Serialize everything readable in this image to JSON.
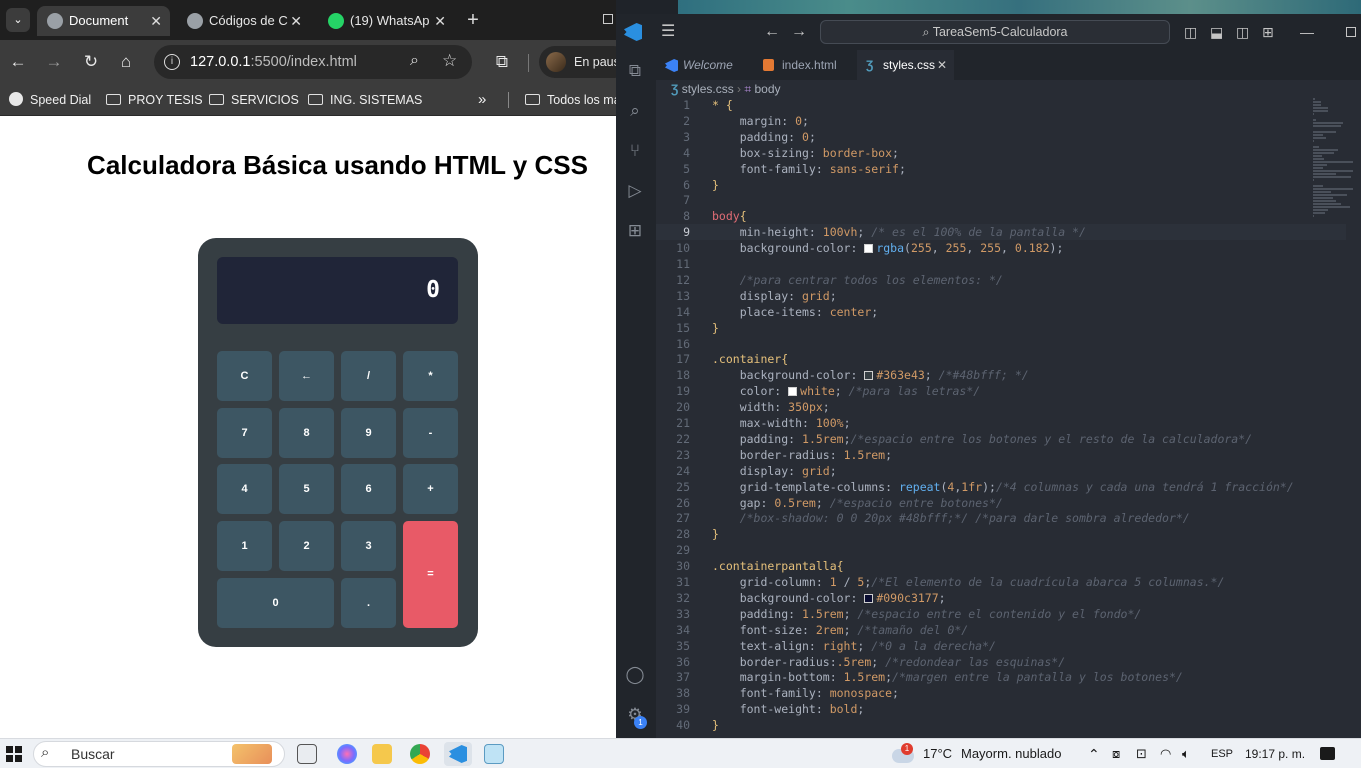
{
  "browser": {
    "tabs": [
      {
        "label": "Document",
        "active": true,
        "icon": "globe-icon"
      },
      {
        "label": "Códigos de C",
        "active": false,
        "icon": "globe-icon"
      },
      {
        "label": "(19) WhatsAp",
        "active": false,
        "icon": "whatsapp-icon"
      }
    ],
    "close_glyph": "✕",
    "new_tab_glyph": "+",
    "url_host": "127.0.0.1",
    "url_rest": ":5500/index.html",
    "profile_label": "En paus",
    "bookmarks": [
      "Speed Dial",
      "PROY TESIS",
      "SERVICIOS",
      "ING. SISTEMAS",
      "»",
      "Todos los ma"
    ]
  },
  "page": {
    "title": "Calculadora Básica usando HTML y CSS",
    "display": "0",
    "keys": [
      "C",
      "←",
      "/",
      "*",
      "7",
      "8",
      "9",
      "-",
      "4",
      "5",
      "6",
      "+",
      "1",
      "2",
      "3",
      "=",
      "0",
      "."
    ],
    "colors": {
      "calc_bg": "#363e43",
      "screen_bg": "#202538",
      "key_bg": "#3d5663",
      "equals_bg": "#e85a67"
    }
  },
  "vscode": {
    "command_center": "TareaSem5-Calculadora",
    "editor_tabs": [
      {
        "label": "Welcome",
        "active": false
      },
      {
        "label": "index.html",
        "active": false
      },
      {
        "label": "styles.css",
        "active": true
      }
    ],
    "breadcrumb": [
      "styles.css",
      "body"
    ],
    "settings_badge": "1",
    "current_line": 9,
    "code_lines": [
      [
        [
          "* ",
          "t-sel"
        ],
        [
          "{",
          "t-br"
        ]
      ],
      [
        [
          "    margin: ",
          "t-prop"
        ],
        [
          "0",
          "t-num"
        ],
        [
          ";",
          "t-pun"
        ]
      ],
      [
        [
          "    padding: ",
          "t-prop"
        ],
        [
          "0",
          "t-num"
        ],
        [
          ";",
          "t-pun"
        ]
      ],
      [
        [
          "    box-sizing: ",
          "t-prop"
        ],
        [
          "border-box",
          "t-kw"
        ],
        [
          ";",
          "t-pun"
        ]
      ],
      [
        [
          "    font-family: ",
          "t-prop"
        ],
        [
          "sans-serif",
          "t-kw"
        ],
        [
          ";",
          "t-pun"
        ]
      ],
      [
        [
          "}",
          "t-br"
        ]
      ],
      [],
      [
        [
          "body",
          "t-tag"
        ],
        [
          "{",
          "t-br"
        ]
      ],
      [
        [
          "    min-height: ",
          "t-prop"
        ],
        [
          "100vh",
          "t-num"
        ],
        [
          "; ",
          "t-pun"
        ],
        [
          "/* es el 100% de la pantalla */",
          "t-com"
        ]
      ],
      [
        [
          "    background-color: ",
          "t-prop"
        ],
        [
          "@#ffffff",
          "sw"
        ],
        [
          "rgba",
          "t-fn"
        ],
        [
          "(",
          "t-pun"
        ],
        [
          "255",
          "t-num"
        ],
        [
          ", ",
          "t-pun"
        ],
        [
          "255",
          "t-num"
        ],
        [
          ", ",
          "t-pun"
        ],
        [
          "255",
          "t-num"
        ],
        [
          ", ",
          "t-pun"
        ],
        [
          "0.182",
          "t-num"
        ],
        [
          ");",
          "t-pun"
        ]
      ],
      [],
      [
        [
          "    /*para centrar todos los elementos: */",
          "t-com"
        ]
      ],
      [
        [
          "    display: ",
          "t-prop"
        ],
        [
          "grid",
          "t-kw"
        ],
        [
          ";",
          "t-pun"
        ]
      ],
      [
        [
          "    place-items: ",
          "t-prop"
        ],
        [
          "center",
          "t-kw"
        ],
        [
          ";",
          "t-pun"
        ]
      ],
      [
        [
          "}",
          "t-br"
        ]
      ],
      [],
      [
        [
          ".container",
          "t-sel"
        ],
        [
          "{",
          "t-br"
        ]
      ],
      [
        [
          "    background-color: ",
          "t-prop"
        ],
        [
          "@#363e43",
          "sw"
        ],
        [
          "#363e43",
          "t-num"
        ],
        [
          "; ",
          "t-pun"
        ],
        [
          "/*#48bfff; */",
          "t-com"
        ]
      ],
      [
        [
          "    color: ",
          "t-prop"
        ],
        [
          "@#ffffff",
          "sw"
        ],
        [
          "white",
          "t-kw"
        ],
        [
          "; ",
          "t-pun"
        ],
        [
          "/*para las letras*/",
          "t-com"
        ]
      ],
      [
        [
          "    width: ",
          "t-prop"
        ],
        [
          "350px",
          "t-num"
        ],
        [
          ";",
          "t-pun"
        ]
      ],
      [
        [
          "    max-width: ",
          "t-prop"
        ],
        [
          "100%",
          "t-num"
        ],
        [
          ";",
          "t-pun"
        ]
      ],
      [
        [
          "    padding: ",
          "t-prop"
        ],
        [
          "1.5rem",
          "t-num"
        ],
        [
          ";",
          "t-pun"
        ],
        [
          "/*espacio entre los botones y el resto de la calculadora*/",
          "t-com"
        ]
      ],
      [
        [
          "    border-radius: ",
          "t-prop"
        ],
        [
          "1.5rem",
          "t-num"
        ],
        [
          ";",
          "t-pun"
        ]
      ],
      [
        [
          "    display: ",
          "t-prop"
        ],
        [
          "grid",
          "t-kw"
        ],
        [
          ";",
          "t-pun"
        ]
      ],
      [
        [
          "    grid-template-columns: ",
          "t-prop"
        ],
        [
          "repeat",
          "t-fn"
        ],
        [
          "(",
          "t-pun"
        ],
        [
          "4",
          "t-num"
        ],
        [
          ",",
          "t-pun"
        ],
        [
          "1fr",
          "t-num"
        ],
        [
          ");",
          "t-pun"
        ],
        [
          "/*4 columnas y cada una tendrá 1 fracción*/",
          "t-com"
        ]
      ],
      [
        [
          "    gap: ",
          "t-prop"
        ],
        [
          "0.5rem",
          "t-num"
        ],
        [
          "; ",
          "t-pun"
        ],
        [
          "/*espacio entre botones*/",
          "t-com"
        ]
      ],
      [
        [
          "    /*box-shadow: 0 0 20px #48bfff;*/ /*para darle sombra alrededor*/",
          "t-com"
        ]
      ],
      [
        [
          "}",
          "t-br"
        ]
      ],
      [],
      [
        [
          ".containerpantalla",
          "t-sel"
        ],
        [
          "{",
          "t-br"
        ]
      ],
      [
        [
          "    grid-column: ",
          "t-prop"
        ],
        [
          "1",
          "t-num"
        ],
        [
          " / ",
          "t-pun"
        ],
        [
          "5",
          "t-num"
        ],
        [
          ";",
          "t-pun"
        ],
        [
          "/*El elemento de la cuadrícula abarca 5 columnas.*/",
          "t-com"
        ]
      ],
      [
        [
          "    background-color: ",
          "t-prop"
        ],
        [
          "@#090c31",
          "sw"
        ],
        [
          "#090c3177",
          "t-num"
        ],
        [
          ";",
          "t-pun"
        ]
      ],
      [
        [
          "    padding: ",
          "t-prop"
        ],
        [
          "1.5rem",
          "t-num"
        ],
        [
          "; ",
          "t-pun"
        ],
        [
          "/*espacio entre el contenido y el fondo*/",
          "t-com"
        ]
      ],
      [
        [
          "    font-size: ",
          "t-prop"
        ],
        [
          "2rem",
          "t-num"
        ],
        [
          "; ",
          "t-pun"
        ],
        [
          "/*tamaño del 0*/",
          "t-com"
        ]
      ],
      [
        [
          "    text-align: ",
          "t-prop"
        ],
        [
          "right",
          "t-kw"
        ],
        [
          "; ",
          "t-pun"
        ],
        [
          "/*0 a la derecha*/",
          "t-com"
        ]
      ],
      [
        [
          "    border-radius:",
          "t-prop"
        ],
        [
          ".5rem",
          "t-num"
        ],
        [
          "; ",
          "t-pun"
        ],
        [
          "/*redondear las esquinas*/",
          "t-com"
        ]
      ],
      [
        [
          "    margin-bottom: ",
          "t-prop"
        ],
        [
          "1.5rem",
          "t-num"
        ],
        [
          ";",
          "t-pun"
        ],
        [
          "/*margen entre la pantalla y los botones*/",
          "t-com"
        ]
      ],
      [
        [
          "    font-family: ",
          "t-prop"
        ],
        [
          "monospace",
          "t-kw"
        ],
        [
          ";",
          "t-pun"
        ]
      ],
      [
        [
          "    font-weight: ",
          "t-prop"
        ],
        [
          "bold",
          "t-kw"
        ],
        [
          ";",
          "t-pun"
        ]
      ],
      [
        [
          "}",
          "t-br"
        ]
      ]
    ]
  },
  "taskbar": {
    "search_placeholder": "Buscar",
    "weather_temp": "17°C",
    "weather_desc": "Mayorm. nublado",
    "weather_badge": "1",
    "language": "ESP",
    "clock": "19:17 p. m."
  }
}
